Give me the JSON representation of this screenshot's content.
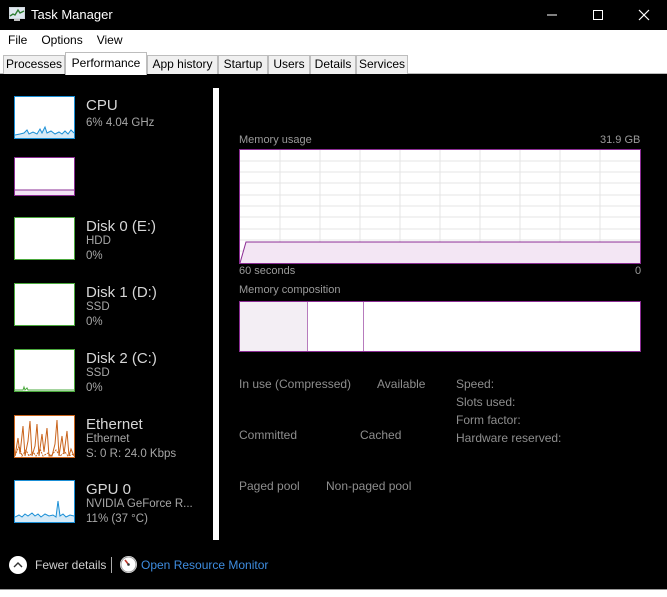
{
  "window": {
    "title": "Task Manager",
    "controls": {
      "minimize": "—",
      "maximize": "☐",
      "close": "✕"
    }
  },
  "menu": [
    "File",
    "Options",
    "View"
  ],
  "tabs": [
    "Processes",
    "Performance",
    "App history",
    "Startup",
    "Users",
    "Details",
    "Services"
  ],
  "active_tab": "Performance",
  "sidebar": [
    {
      "title": "CPU",
      "sub1": "6%  4.04 GHz",
      "sub2": "",
      "color": "#1a8fd6"
    },
    {
      "title": "",
      "sub1": "",
      "sub2": "",
      "color": "#8b2c94"
    },
    {
      "title": "Disk 0 (E:)",
      "sub1": "HDD",
      "sub2": "0%",
      "color": "#4aa83c"
    },
    {
      "title": "Disk 1 (D:)",
      "sub1": "SSD",
      "sub2": "0%",
      "color": "#4aa83c"
    },
    {
      "title": "Disk 2 (C:)",
      "sub1": "SSD",
      "sub2": "0%",
      "color": "#4aa83c"
    },
    {
      "title": "Ethernet",
      "sub1": "Ethernet",
      "sub2": "S: 0  R: 24.0 Kbps",
      "color": "#c9641c"
    },
    {
      "title": "GPU 0",
      "sub1": "NVIDIA GeForce R...",
      "sub2": "11%  (37 °C)",
      "color": "#1a8fd6"
    }
  ],
  "memory": {
    "usage_label": "Memory usage",
    "total": "31.9 GB",
    "time_label": "60 seconds",
    "zero_label": "0",
    "composition_label": "Memory composition",
    "stats": {
      "in_use": "In use (Compressed)",
      "available": "Available",
      "committed": "Committed",
      "cached": "Cached",
      "paged_pool": "Paged pool",
      "non_paged_pool": "Non-paged pool",
      "speed": "Speed:",
      "slots_used": "Slots used:",
      "form_factor": "Form factor:",
      "hardware_reserved": "Hardware reserved:"
    },
    "accent": "#8b2c94"
  },
  "footer": {
    "fewer_details": "Fewer details",
    "open_resource_monitor": "Open Resource Monitor"
  }
}
